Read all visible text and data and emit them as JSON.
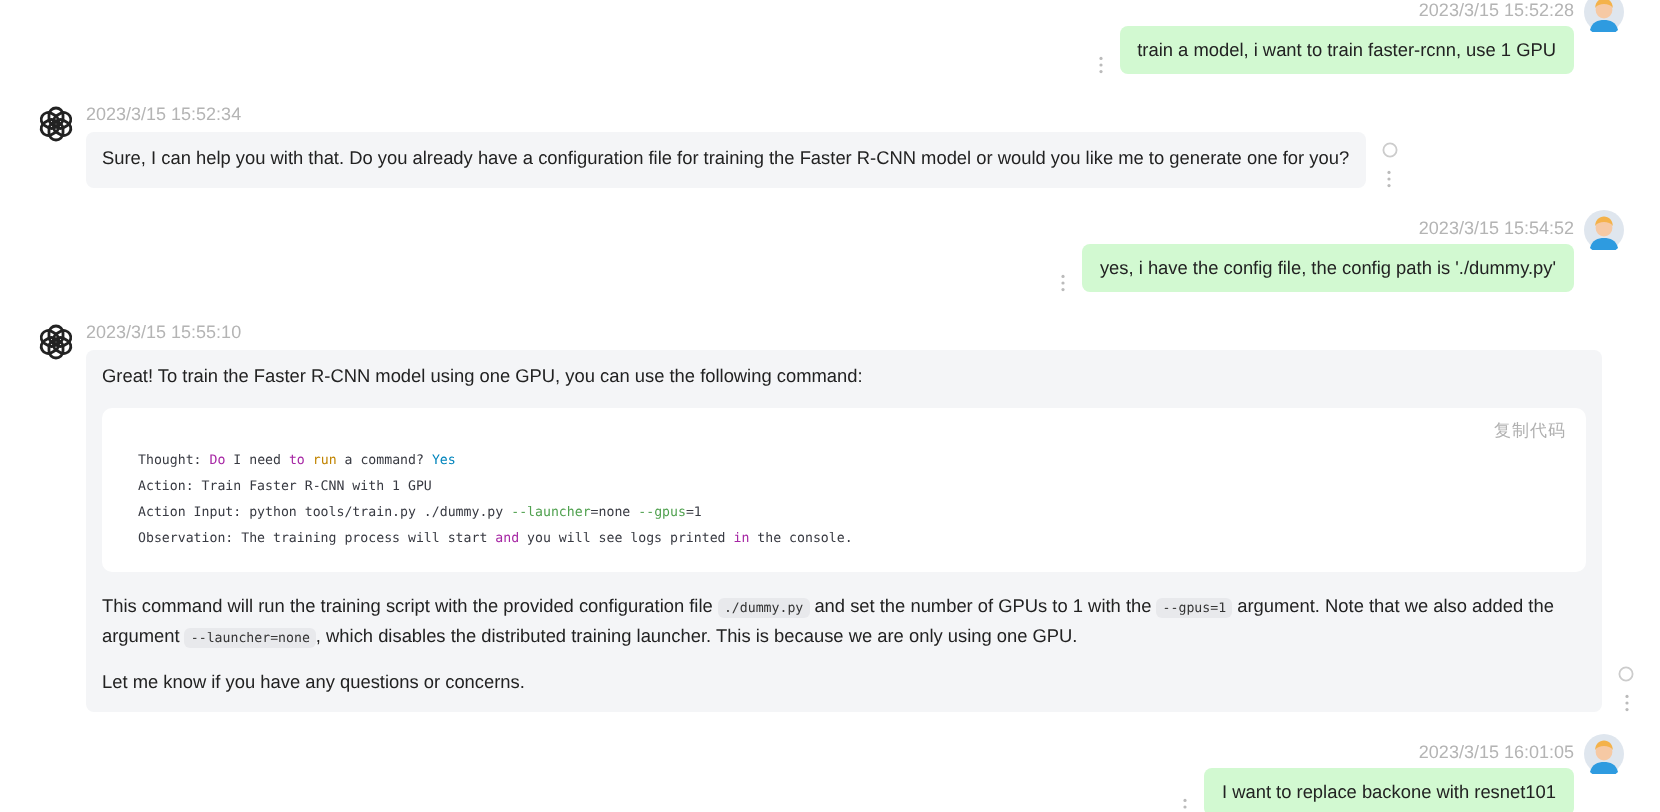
{
  "messages": [
    {
      "kind": "user",
      "time": "2023/3/15 15:52:28",
      "text": "train a model, i want to train faster-rcnn, use 1 GPU"
    },
    {
      "kind": "bot",
      "time": "2023/3/15 15:52:34",
      "blocks": [
        {
          "kind": "paragraph",
          "parts": [
            {
              "kind": "text",
              "text": "Sure, I can help you with that. Do you already have a configuration file for training the Faster R-CNN model or would you like me to generate one for you?"
            }
          ]
        }
      ]
    },
    {
      "kind": "user",
      "time": "2023/3/15 15:54:52",
      "text": "yes, i have the config file, the config path is './dummy.py'"
    },
    {
      "kind": "bot",
      "time": "2023/3/15 15:55:10",
      "blocks": [
        {
          "kind": "paragraph",
          "parts": [
            {
              "kind": "text",
              "text": "Great! To train the Faster R-CNN model using one GPU, you can use the following command:"
            }
          ]
        },
        {
          "kind": "code",
          "copy_label": "复制代码",
          "lines": [
            [
              {
                "kind": "plain",
                "text": "Thought: "
              },
              {
                "kind": "keyword",
                "text": "Do"
              },
              {
                "kind": "plain",
                "text": " I need "
              },
              {
                "kind": "keyword",
                "text": "to "
              },
              {
                "kind": "builtin",
                "text": "run"
              },
              {
                "kind": "plain",
                "text": " a command? "
              },
              {
                "kind": "literal",
                "text": "Yes"
              }
            ],
            [
              {
                "kind": "plain",
                "text": "Action: Train Faster R-CNN with 1 GPU"
              }
            ],
            [
              {
                "kind": "plain",
                "text": "Action Input: python tools/train.py ./dummy.py "
              },
              {
                "kind": "attr",
                "text": "--launcher"
              },
              {
                "kind": "plain",
                "text": "=none "
              },
              {
                "kind": "attr",
                "text": "--gpus"
              },
              {
                "kind": "plain",
                "text": "=1"
              }
            ],
            [
              {
                "kind": "plain",
                "text": "Observation: The training process will start "
              },
              {
                "kind": "keyword",
                "text": "and"
              },
              {
                "kind": "plain",
                "text": " you will see logs printed "
              },
              {
                "kind": "keyword",
                "text": "in"
              },
              {
                "kind": "plain",
                "text": " the console."
              }
            ]
          ]
        },
        {
          "kind": "paragraph",
          "parts": [
            {
              "kind": "text",
              "text": "This command will run the training script with the provided configuration file "
            },
            {
              "kind": "code",
              "text": "./dummy.py"
            },
            {
              "kind": "text",
              "text": " and set the number of GPUs to 1 with the "
            },
            {
              "kind": "code",
              "text": "--gpus=1"
            },
            {
              "kind": "text",
              "text": " argument. Note that we also added the argument "
            },
            {
              "kind": "code",
              "text": "--launcher=none"
            },
            {
              "kind": "text",
              "text": ", which disables the distributed training launcher. This is because we are only using one GPU."
            }
          ]
        },
        {
          "kind": "paragraph",
          "parts": [
            {
              "kind": "text",
              "text": "Let me know if you have any questions or concerns."
            }
          ]
        }
      ]
    },
    {
      "kind": "user",
      "time": "2023/3/15 16:01:05",
      "text": "I want to replace backone with resnet101"
    }
  ]
}
